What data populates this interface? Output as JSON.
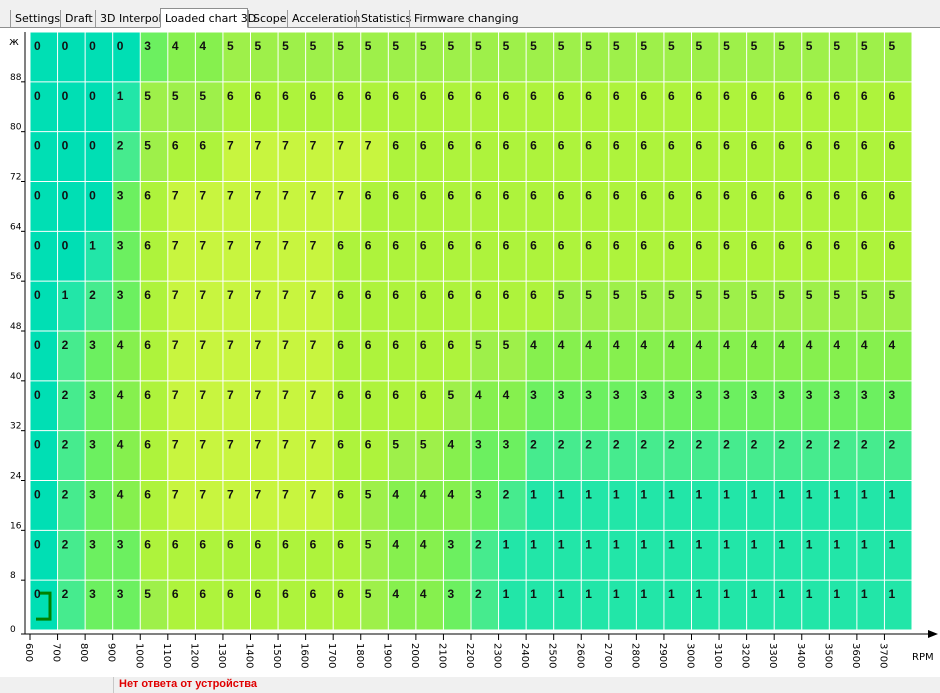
{
  "tabs": [
    {
      "label": "Settings",
      "active": false
    },
    {
      "label": "Draft",
      "active": false
    },
    {
      "label": "3D Interpol",
      "active": false
    },
    {
      "label": "Loaded chart 3D",
      "active": true
    },
    {
      "label": "Scope",
      "active": false
    },
    {
      "label": "Acceleration",
      "active": false
    },
    {
      "label": "Statistics",
      "active": false
    },
    {
      "label": "Firmware changing",
      "active": false
    }
  ],
  "status": {
    "message": "Нет ответа от устройства",
    "color": "#e00000"
  },
  "chart_data": {
    "type": "heatmap",
    "xlabel": "RPM",
    "ylabel": "ж",
    "x_ticks": [
      "600",
      "700",
      "800",
      "900",
      "1000",
      "1100",
      "1200",
      "1300",
      "1400",
      "1500",
      "1600",
      "1700",
      "1800",
      "1900",
      "2000",
      "2100",
      "2200",
      "2300",
      "2400",
      "2500",
      "2600",
      "2700",
      "2800",
      "2900",
      "3000",
      "3100",
      "3200",
      "3300",
      "3400",
      "3500",
      "3600",
      "3700"
    ],
    "y_ticks": [
      "0",
      "8",
      "16",
      "24",
      "32",
      "40",
      "48",
      "56",
      "64",
      "72",
      "80",
      "88"
    ],
    "rows": [
      [
        0,
        0,
        0,
        0,
        3,
        4,
        4,
        5,
        5,
        5,
        5,
        5,
        5,
        5,
        5,
        5,
        5,
        5,
        5,
        5,
        5,
        5,
        5,
        5,
        5,
        5,
        5,
        5,
        5,
        5,
        5,
        5
      ],
      [
        0,
        0,
        0,
        1,
        5,
        5,
        5,
        6,
        6,
        6,
        6,
        6,
        6,
        6,
        6,
        6,
        6,
        6,
        6,
        6,
        6,
        6,
        6,
        6,
        6,
        6,
        6,
        6,
        6,
        6,
        6,
        6
      ],
      [
        0,
        0,
        0,
        2,
        5,
        6,
        6,
        7,
        7,
        7,
        7,
        7,
        7,
        6,
        6,
        6,
        6,
        6,
        6,
        6,
        6,
        6,
        6,
        6,
        6,
        6,
        6,
        6,
        6,
        6,
        6,
        6
      ],
      [
        0,
        0,
        0,
        3,
        6,
        7,
        7,
        7,
        7,
        7,
        7,
        7,
        6,
        6,
        6,
        6,
        6,
        6,
        6,
        6,
        6,
        6,
        6,
        6,
        6,
        6,
        6,
        6,
        6,
        6,
        6,
        6
      ],
      [
        0,
        0,
        1,
        3,
        6,
        7,
        7,
        7,
        7,
        7,
        7,
        6,
        6,
        6,
        6,
        6,
        6,
        6,
        6,
        6,
        6,
        6,
        6,
        6,
        6,
        6,
        6,
        6,
        6,
        6,
        6,
        6
      ],
      [
        0,
        1,
        2,
        3,
        6,
        7,
        7,
        7,
        7,
        7,
        7,
        6,
        6,
        6,
        6,
        6,
        6,
        6,
        6,
        5,
        5,
        5,
        5,
        5,
        5,
        5,
        5,
        5,
        5,
        5,
        5,
        5
      ],
      [
        0,
        2,
        3,
        4,
        6,
        7,
        7,
        7,
        7,
        7,
        7,
        6,
        6,
        6,
        6,
        6,
        5,
        5,
        4,
        4,
        4,
        4,
        4,
        4,
        4,
        4,
        4,
        4,
        4,
        4,
        4,
        4
      ],
      [
        0,
        2,
        3,
        4,
        6,
        7,
        7,
        7,
        7,
        7,
        7,
        6,
        6,
        6,
        6,
        5,
        4,
        4,
        3,
        3,
        3,
        3,
        3,
        3,
        3,
        3,
        3,
        3,
        3,
        3,
        3,
        3
      ],
      [
        0,
        2,
        3,
        4,
        6,
        7,
        7,
        7,
        7,
        7,
        7,
        6,
        6,
        5,
        5,
        4,
        3,
        3,
        2,
        2,
        2,
        2,
        2,
        2,
        2,
        2,
        2,
        2,
        2,
        2,
        2,
        2
      ],
      [
        0,
        2,
        3,
        4,
        6,
        7,
        7,
        7,
        7,
        7,
        7,
        6,
        5,
        4,
        4,
        4,
        3,
        2,
        1,
        1,
        1,
        1,
        1,
        1,
        1,
        1,
        1,
        1,
        1,
        1,
        1,
        1
      ],
      [
        0,
        2,
        3,
        3,
        6,
        6,
        6,
        6,
        6,
        6,
        6,
        6,
        5,
        4,
        4,
        3,
        2,
        1,
        1,
        1,
        1,
        1,
        1,
        1,
        1,
        1,
        1,
        1,
        1,
        1,
        1,
        1
      ],
      [
        0,
        2,
        3,
        3,
        5,
        6,
        6,
        6,
        6,
        6,
        6,
        6,
        5,
        4,
        4,
        3,
        2,
        1,
        1,
        1,
        1,
        1,
        1,
        1,
        1,
        1,
        1,
        1,
        1,
        1,
        1,
        1
      ]
    ],
    "color_scale": [
      "#00dfb4",
      "#22e6a8",
      "#46eb8e",
      "#6cf060",
      "#86f04e",
      "#9ef04a",
      "#aef33c",
      "#c8f53f"
    ],
    "cursor": {
      "row": 11,
      "col": 0,
      "color": "#008000"
    },
    "grid": true
  }
}
